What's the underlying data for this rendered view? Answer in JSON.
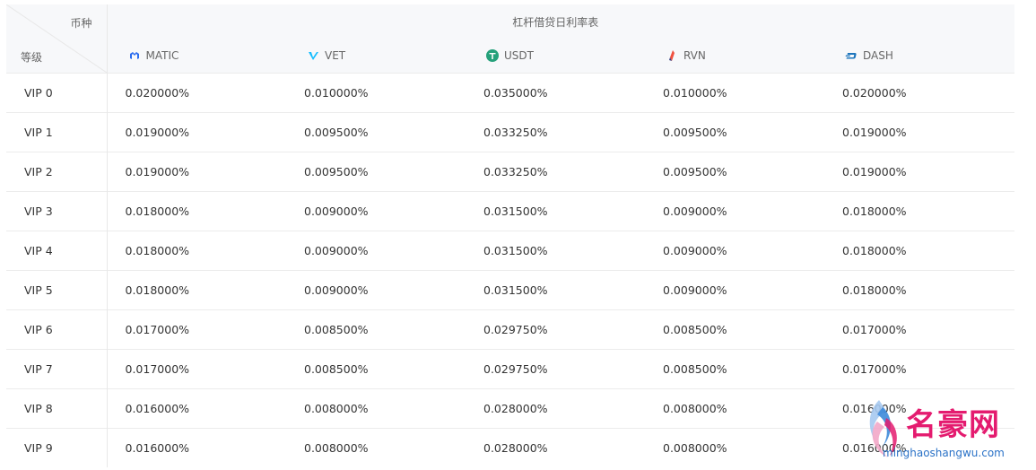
{
  "table": {
    "corner_currency": "币种",
    "corner_level": "等级",
    "title": "杠杆借贷日利率表",
    "coins": [
      {
        "name": "MATIC",
        "icon": "matic-icon"
      },
      {
        "name": "VET",
        "icon": "vet-icon"
      },
      {
        "name": "USDT",
        "icon": "usdt-icon"
      },
      {
        "name": "RVN",
        "icon": "rvn-icon"
      },
      {
        "name": "DASH",
        "icon": "dash-icon"
      }
    ],
    "rows": [
      {
        "level": "VIP 0",
        "values": [
          "0.020000%",
          "0.010000%",
          "0.035000%",
          "0.010000%",
          "0.020000%"
        ],
        "partial": "0"
      },
      {
        "level": "VIP 1",
        "values": [
          "0.019000%",
          "0.009500%",
          "0.033250%",
          "0.009500%",
          "0.019000%"
        ],
        "partial": "0"
      },
      {
        "level": "VIP 2",
        "values": [
          "0.019000%",
          "0.009500%",
          "0.033250%",
          "0.009500%",
          "0.019000%"
        ],
        "partial": "0"
      },
      {
        "level": "VIP 3",
        "values": [
          "0.018000%",
          "0.009000%",
          "0.031500%",
          "0.009000%",
          "0.018000%"
        ],
        "partial": "0"
      },
      {
        "level": "VIP 4",
        "values": [
          "0.018000%",
          "0.009000%",
          "0.031500%",
          "0.009000%",
          "0.018000%"
        ],
        "partial": "0"
      },
      {
        "level": "VIP 5",
        "values": [
          "0.018000%",
          "0.009000%",
          "0.031500%",
          "0.009000%",
          "0.018000%"
        ],
        "partial": "0"
      },
      {
        "level": "VIP 6",
        "values": [
          "0.017000%",
          "0.008500%",
          "0.029750%",
          "0.008500%",
          "0.017000%"
        ],
        "partial": "0"
      },
      {
        "level": "VIP 7",
        "values": [
          "0.017000%",
          "0.008500%",
          "0.029750%",
          "0.008500%",
          "0.017000%"
        ],
        "partial": "0"
      },
      {
        "level": "VIP 8",
        "values": [
          "0.016000%",
          "0.008000%",
          "0.028000%",
          "0.008000%",
          "0.016000%"
        ],
        "partial": "0"
      },
      {
        "level": "VIP 9",
        "values": [
          "0.016000%",
          "0.008000%",
          "0.028000%",
          "0.008000%",
          "0.016000%"
        ],
        "partial": "0"
      }
    ]
  },
  "colors": {
    "matic": "#2b6def",
    "vet": "#15bdff",
    "usdt": "#26a17b",
    "rvn": "#f0513f",
    "dash": "#1c75bc"
  },
  "watermark": {
    "brand": "名豪网",
    "url": "minghaoshangwu.com"
  }
}
